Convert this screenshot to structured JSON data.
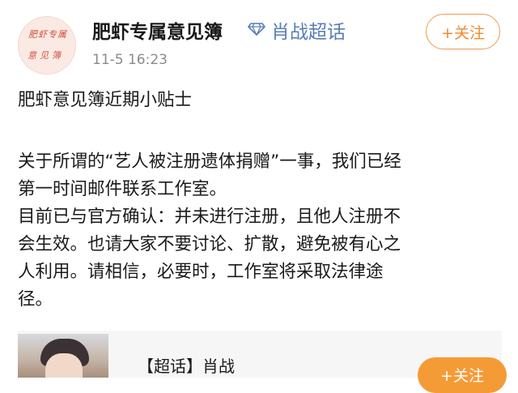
{
  "header": {
    "avatar_lines": [
      "肥虾专属",
      "意见簿"
    ],
    "account_name": "肥虾专属意见簿",
    "topic_icon": "diamond-icon",
    "topic_name": "肖战超话",
    "timestamp": "11-5 16:23",
    "follow_label": "+关注"
  },
  "post": {
    "title": "肥虾意见簿近期小贴士",
    "paragraph1_lines": [
      "关于所谓的“艺人被注册遗体捐赠”一事，我们已经",
      "第一时间邮件联系工作室。"
    ],
    "paragraph2_lines": [
      "目前已与官方确认：并未进行注册，且他人注册不",
      "会生效。也请大家不要讨论、扩散，避免被有心之",
      "人利用。请相信，必要时，工作室将采取法律途",
      "径。"
    ]
  },
  "card": {
    "title": "【超话】肖战",
    "follow_label": "+关注"
  },
  "colors": {
    "accent_orange": "#f08a2c",
    "topic_blue": "#5a7db5",
    "timestamp_gray": "#8a8a8a"
  }
}
